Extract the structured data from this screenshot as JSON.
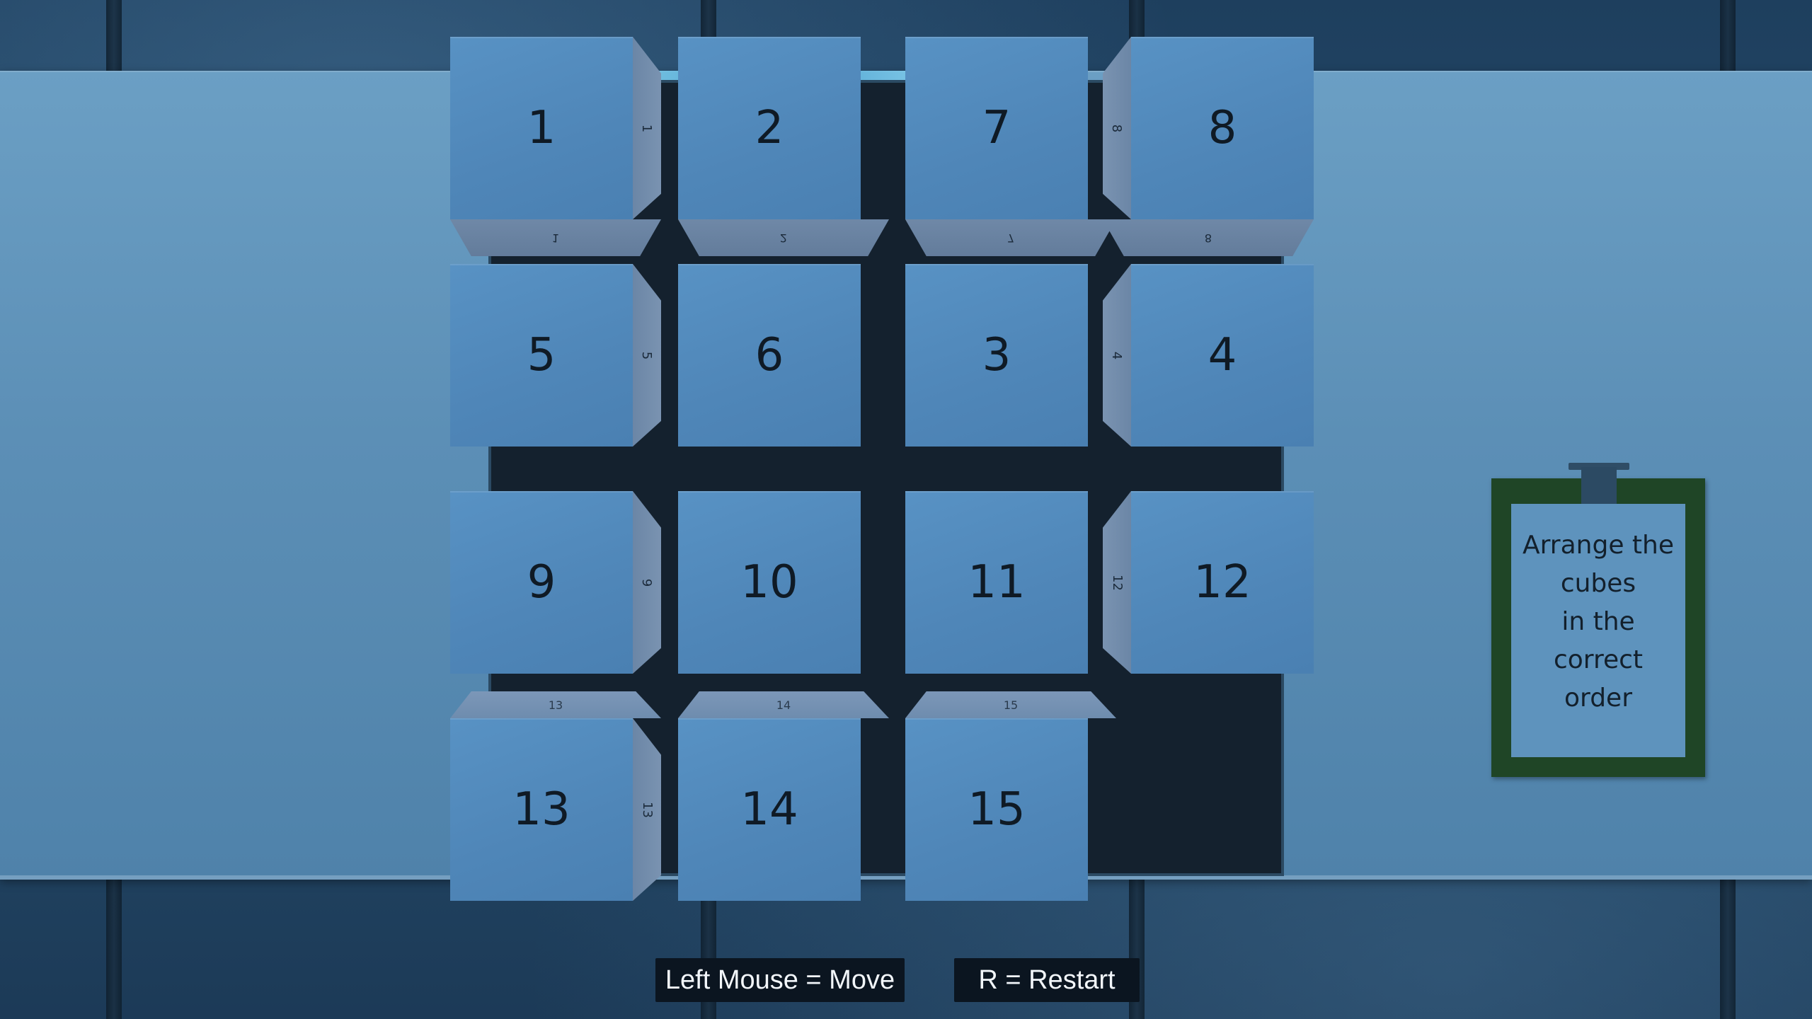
{
  "tiles": [
    {
      "label": "1"
    },
    {
      "label": "2"
    },
    {
      "label": "7"
    },
    {
      "label": "8"
    },
    {
      "label": "5"
    },
    {
      "label": "6"
    },
    {
      "label": "3"
    },
    {
      "label": "4"
    },
    {
      "label": "9"
    },
    {
      "label": "10"
    },
    {
      "label": "11"
    },
    {
      "label": "12"
    },
    {
      "label": "13"
    },
    {
      "label": "14"
    },
    {
      "label": "15"
    }
  ],
  "empty_slot": {
    "row": 4,
    "col": 4
  },
  "note": {
    "lines": [
      "Arrange the",
      "cubes",
      "in the",
      "correct",
      "order"
    ]
  },
  "hints": {
    "move": "Left Mouse = Move",
    "restart": "R = Restart"
  },
  "colors": {
    "cube_face": "#5089bb",
    "board": "#14212e",
    "note_frame": "#1f4526",
    "note_paper": "#5e93bd"
  }
}
